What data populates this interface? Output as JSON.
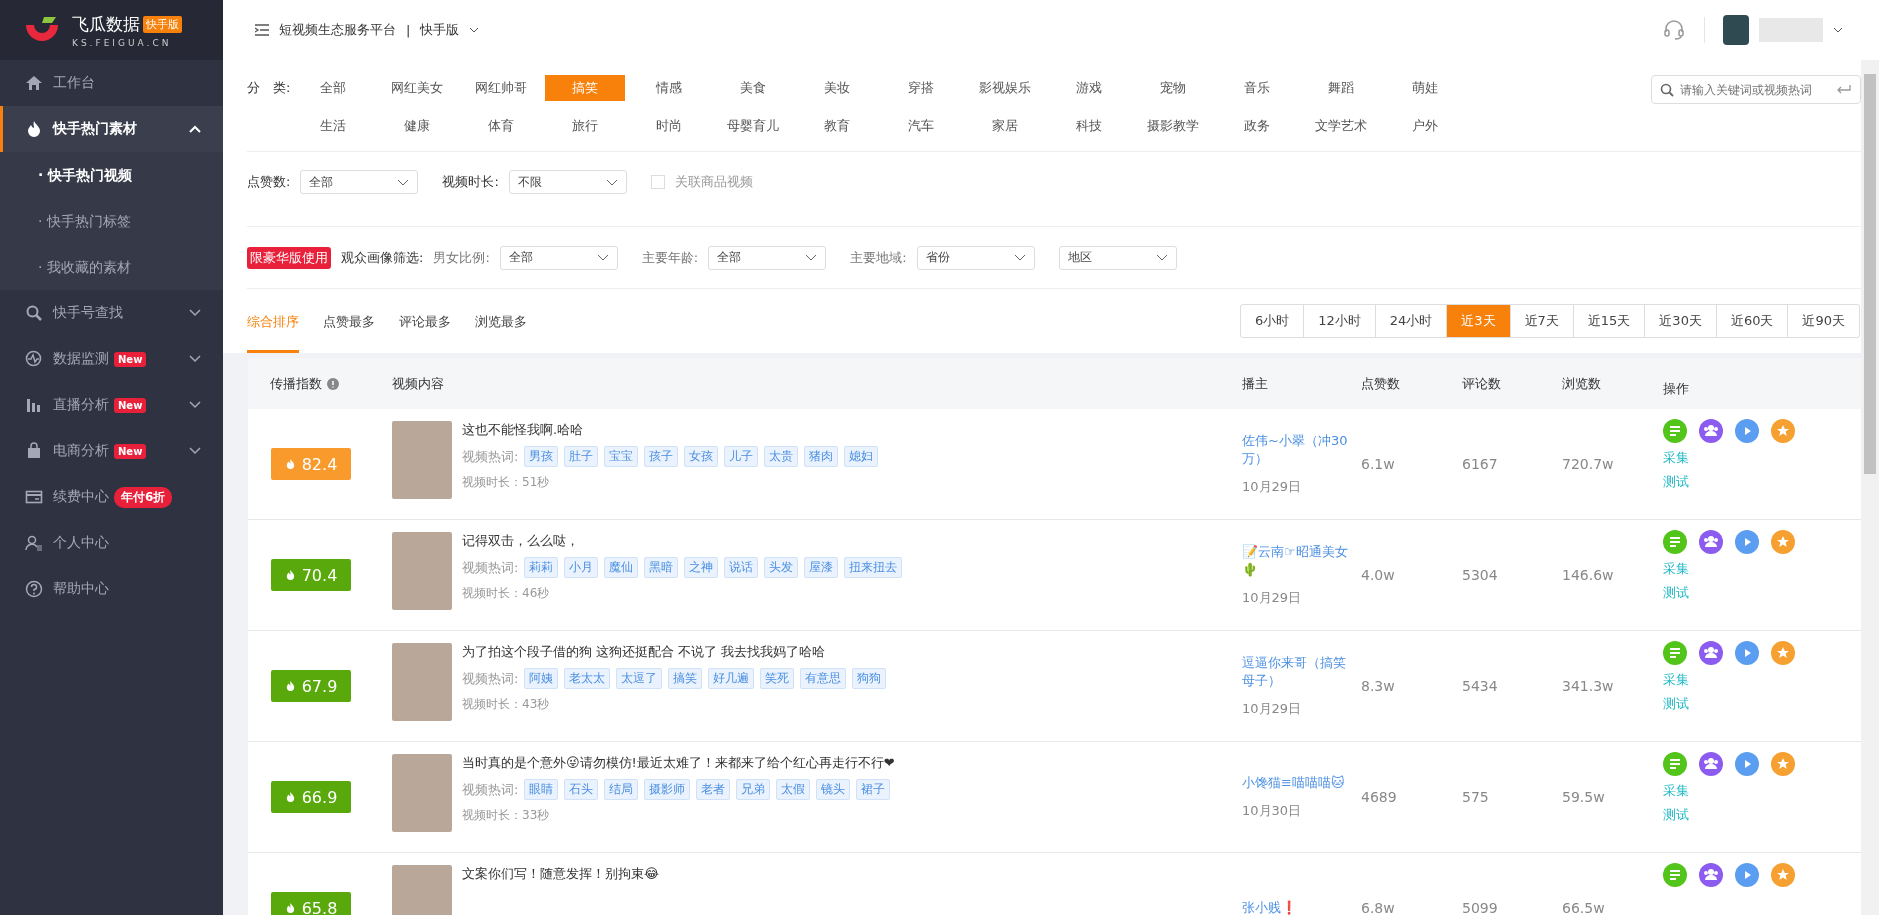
{
  "sidebar": {
    "logo": {
      "name": "飞瓜数据",
      "badge": "快手版",
      "domain": "KS.FEIGUA.CN"
    },
    "items": [
      {
        "label": "工作台",
        "kind": "link",
        "selected": false
      },
      {
        "label": "快手热门素材",
        "kind": "group",
        "expanded": true,
        "selected": true,
        "children": [
          {
            "label": "· 快手热门视频",
            "selected": true
          },
          {
            "label": "· 快手热门标签",
            "selected": false
          },
          {
            "label": "· 我收藏的素材",
            "selected": false
          }
        ]
      },
      {
        "label": "快手号查找",
        "kind": "group",
        "expanded": false,
        "selected": false
      },
      {
        "label": "数据监测",
        "kind": "group",
        "expanded": false,
        "selected": false,
        "badge": "New"
      },
      {
        "label": "直播分析",
        "kind": "group",
        "expanded": false,
        "selected": false,
        "badge": "New"
      },
      {
        "label": "电商分析",
        "kind": "group",
        "expanded": false,
        "selected": false,
        "badge": "New"
      },
      {
        "label": "续费中心",
        "kind": "link",
        "selected": false,
        "badge": "年付6折"
      },
      {
        "label": "个人中心",
        "kind": "link",
        "selected": false
      },
      {
        "label": "帮助中心",
        "kind": "link",
        "selected": false
      }
    ]
  },
  "topbar": {
    "platform": "短视频生态服务平台",
    "separator": "|",
    "version": "快手版"
  },
  "categories": {
    "label": "分　类:",
    "items": [
      {
        "label": "全部",
        "selected": false
      },
      {
        "label": "网红美女",
        "selected": false
      },
      {
        "label": "网红帅哥",
        "selected": false
      },
      {
        "label": "搞笑",
        "selected": true
      },
      {
        "label": "情感",
        "selected": false
      },
      {
        "label": "美食",
        "selected": false
      },
      {
        "label": "美妆",
        "selected": false
      },
      {
        "label": "穿搭",
        "selected": false
      },
      {
        "label": "影视娱乐",
        "selected": false
      },
      {
        "label": "游戏",
        "selected": false
      },
      {
        "label": "宠物",
        "selected": false
      },
      {
        "label": "音乐",
        "selected": false
      },
      {
        "label": "舞蹈",
        "selected": false
      },
      {
        "label": "萌娃",
        "selected": false
      },
      {
        "label": "生活",
        "selected": false
      },
      {
        "label": "健康",
        "selected": false
      },
      {
        "label": "体育",
        "selected": false
      },
      {
        "label": "旅行",
        "selected": false
      },
      {
        "label": "时尚",
        "selected": false
      },
      {
        "label": "母婴育儿",
        "selected": false
      },
      {
        "label": "教育",
        "selected": false
      },
      {
        "label": "汽车",
        "selected": false
      },
      {
        "label": "家居",
        "selected": false
      },
      {
        "label": "科技",
        "selected": false
      },
      {
        "label": "摄影教学",
        "selected": false
      },
      {
        "label": "政务",
        "selected": false
      },
      {
        "label": "文学艺术",
        "selected": false
      },
      {
        "label": "户外",
        "selected": false
      }
    ]
  },
  "search": {
    "placeholder": "请输入关键词或视频热词"
  },
  "filters": [
    {
      "label": "点赞数:",
      "value": "全部"
    },
    {
      "label": "视频时长:",
      "value": "不限"
    }
  ],
  "product_checkbox": {
    "label": "关联商品视频",
    "checked": false
  },
  "audience": {
    "badge": "限豪华版使用",
    "label": "观众画像筛选:",
    "selects": [
      {
        "label": "男女比例:",
        "value": "全部"
      },
      {
        "label": "主要年龄:",
        "value": "全部"
      },
      {
        "label": "主要地域:",
        "value": "省份"
      },
      {
        "value": "地区"
      }
    ]
  },
  "sort_tabs": [
    {
      "label": "综合排序",
      "selected": true
    },
    {
      "label": "点赞最多",
      "selected": false
    },
    {
      "label": "评论最多",
      "selected": false
    },
    {
      "label": "浏览最多",
      "selected": false
    }
  ],
  "time_ranges": [
    {
      "label": "6小时",
      "selected": false
    },
    {
      "label": "12小时",
      "selected": false
    },
    {
      "label": "24小时",
      "selected": false
    },
    {
      "label": "近3天",
      "selected": true
    },
    {
      "label": "近7天",
      "selected": false
    },
    {
      "label": "近15天",
      "selected": false
    },
    {
      "label": "近30天",
      "selected": false
    },
    {
      "label": "近60天",
      "selected": false
    },
    {
      "label": "近90天",
      "selected": false
    }
  ],
  "table": {
    "columns": [
      "传播指数",
      "视频内容",
      "播主",
      "点赞数",
      "评论数",
      "浏览数",
      "操作"
    ],
    "rows": [
      {
        "score": "82.4",
        "color": "#f89a2c",
        "title": "这也不能怪我啊.哈哈",
        "tags_label": "视频热词:",
        "tags": [
          "男孩",
          "肚子",
          "宝宝",
          "孩子",
          "女孩",
          "儿子",
          "太贵",
          "猪肉",
          "媳妇"
        ],
        "duration": "视频时长：51秒",
        "author": "佐伟~小翠（冲30万）",
        "date": "10月29日",
        "likes": "6.1w",
        "comments": "6167",
        "views": "720.7w",
        "actions": [
          "采集",
          "测试"
        ]
      },
      {
        "score": "70.4",
        "color": "#5aa90c",
        "title": "记得双击，么么哒，",
        "tags_label": "视频热词:",
        "tags": [
          "莉莉",
          "小月",
          "魔仙",
          "黑暗",
          "之神",
          "说话",
          "头发",
          "屋漆",
          "扭来扭去"
        ],
        "duration": "视频时长：46秒",
        "author": "📝云南☞昭通美女🌵",
        "date": "10月29日",
        "likes": "4.0w",
        "comments": "5304",
        "views": "146.6w",
        "actions": [
          "采集",
          "测试"
        ]
      },
      {
        "score": "67.9",
        "color": "#5aa90c",
        "title": "为了拍这个段子借的狗 这狗还挺配合 不说了 我去找我妈了哈哈",
        "tags_label": "视频热词:",
        "tags": [
          "阿姨",
          "老太太",
          "太逗了",
          "搞笑",
          "好几遍",
          "笑死",
          "有意思",
          "狗狗"
        ],
        "duration": "视频时长：43秒",
        "author": "逗逼你来哥（搞笑母子）",
        "date": "10月29日",
        "likes": "8.3w",
        "comments": "5434",
        "views": "341.3w",
        "actions": [
          "采集",
          "测试"
        ]
      },
      {
        "score": "66.9",
        "color": "#5aa90c",
        "title": "当时真的是个意外😜请勿模仿!最近太难了！来都来了给个红心再走行不行❤",
        "tags_label": "视频热词:",
        "tags": [
          "眼睛",
          "石头",
          "结局",
          "摄影师",
          "老者",
          "兄弟",
          "太假",
          "镜头",
          "裙子"
        ],
        "duration": "视频时长：33秒",
        "author": "小馋猫≡喵喵喵🐱",
        "date": "10月30日",
        "likes": "4689",
        "comments": "575",
        "views": "59.5w",
        "actions": [
          "采集",
          "测试"
        ]
      },
      {
        "score": "65.8",
        "color": "#5aa90c",
        "title": "文案你们写！随意发挥！别拘束😂",
        "author": "张小贱❗",
        "likes": "6.8w",
        "comments": "5099",
        "views": "66.5w"
      }
    ]
  }
}
